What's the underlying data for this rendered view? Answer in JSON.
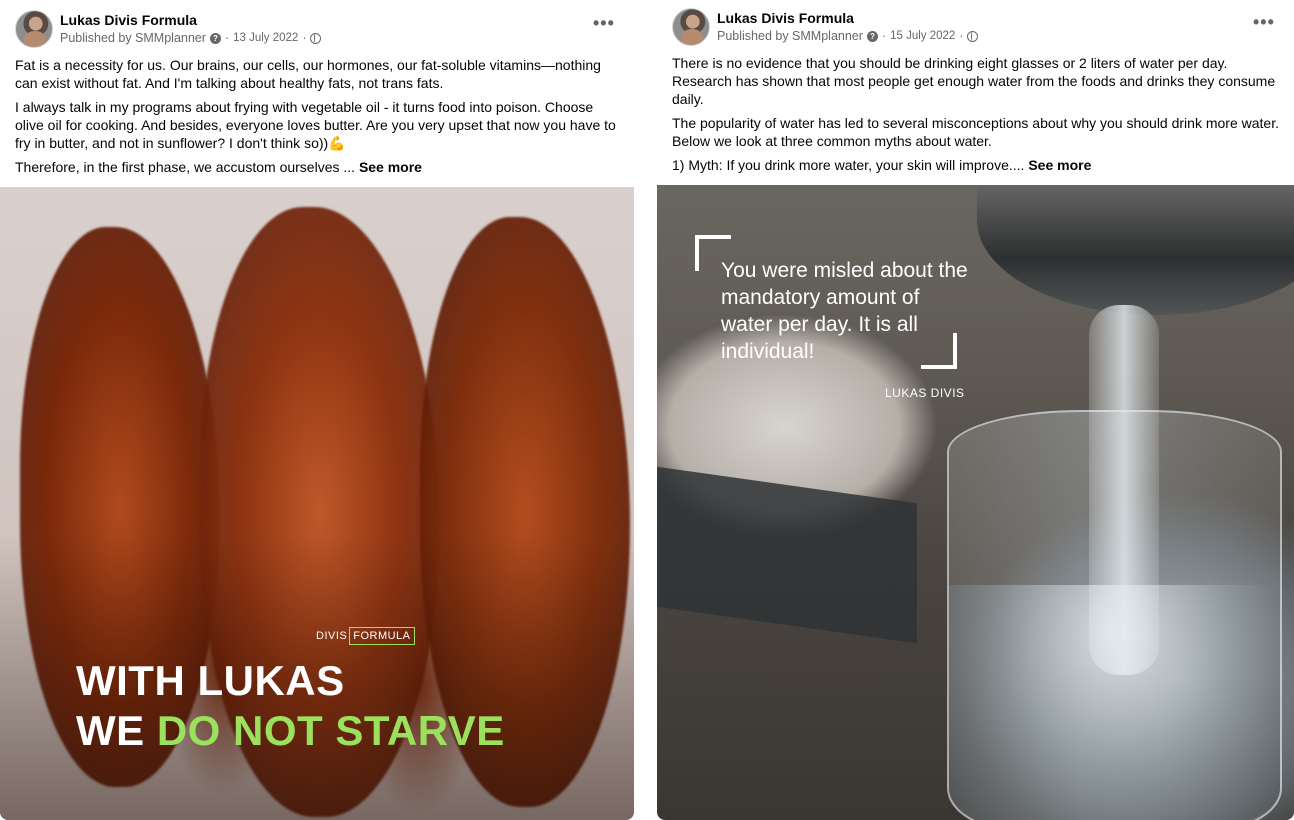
{
  "posts": [
    {
      "author": "Lukas Divis Formula",
      "published_by": "Published by SMMplanner",
      "date": "13 July 2022",
      "paragraphs": [
        "Fat is a necessity for us. Our brains, our cells, our hormones, our fat-soluble vitamins—nothing can exist without fat. And I'm talking about healthy fats, not trans fats.",
        "I always talk in my programs about frying with vegetable oil - it turns food into poison. Choose olive oil for cooking. And besides, everyone loves butter. Are you very upset that now you have to fry in butter, and not in sunflower? I don't think so))💪",
        "Therefore, in the first phase, we accustom ourselves ..."
      ],
      "see_more": "See more",
      "image": {
        "brand_left": "DIVIS",
        "brand_right": "FORMULA",
        "line1": "WITH LUKAS",
        "line2_white": "WE ",
        "line2_green": "DO NOT STARVE"
      }
    },
    {
      "author": "Lukas Divis Formula",
      "published_by": "Published by SMMplanner",
      "date": "15 July 2022",
      "paragraphs": [
        "There is no evidence that you should be drinking eight glasses or 2 liters of water per day. Research has shown that most people get enough water from the foods and drinks they consume daily.",
        "The popularity of water has led to several misconceptions about why you should drink more water. Below we look at three common myths about water.",
        "1) Myth: If you drink more water, your skin will improve...."
      ],
      "see_more": "See more",
      "image": {
        "quote": "You were misled about the mandatory amount of water per day. It is all individual!",
        "signature": "LUKAS DIVIS"
      }
    }
  ],
  "colors": {
    "text": "#050505",
    "secondary": "#65676b",
    "brand_green": "#9be15d"
  }
}
